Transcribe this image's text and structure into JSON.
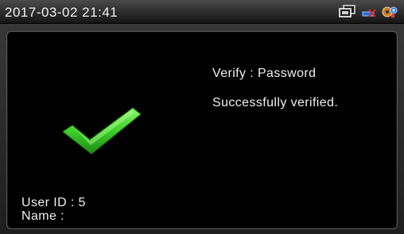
{
  "status_bar": {
    "datetime": "2017-03-02 21:41",
    "icons": [
      "network-icon",
      "disconnected-icon",
      "settings-icon"
    ]
  },
  "verification": {
    "method_line": "Verify : Password",
    "result_line": "Successfully verified.",
    "result_icon": "green-checkmark-icon",
    "accent_color": "#3ecf2a"
  },
  "user": {
    "id_line": "User ID : 5",
    "name_line": "Name :"
  }
}
